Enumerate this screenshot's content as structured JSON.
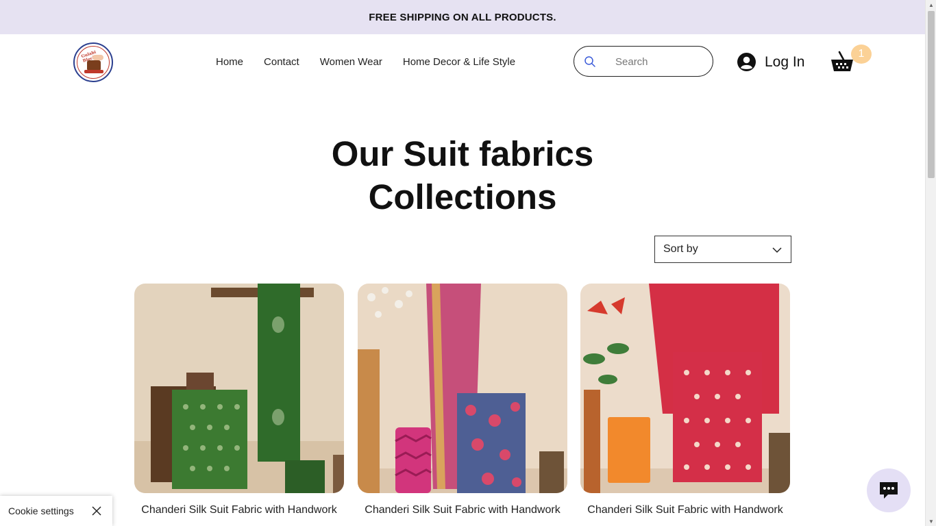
{
  "promo": {
    "text": "FREE SHIPPING ON ALL PRODUCTS."
  },
  "header": {
    "logo_text": "Gulabi Blocks",
    "nav": [
      "Home",
      "Contact",
      "Women Wear",
      "Home Decor & Life Style"
    ],
    "search_placeholder": "Search",
    "login_label": "Log In",
    "cart_count": "1"
  },
  "main": {
    "title_line1": "Our Suit fabrics",
    "title_line2": "Collections",
    "sort_label": "Sort by",
    "products": [
      {
        "title": "Chanderi Silk Suit Fabric with Handwork"
      },
      {
        "title": "Chanderi Silk Suit Fabric with Handwork"
      },
      {
        "title": "Chanderi Silk Suit Fabric with Handwork"
      }
    ]
  },
  "cookie": {
    "label": "Cookie settings"
  },
  "colors": {
    "promo_bg": "#e6e2f2",
    "cart_badge": "#fbd196",
    "chat_bg": "#e4dff5"
  },
  "icons": {
    "search": "search-icon",
    "user": "user-avatar-icon",
    "cart": "cart-basket-icon",
    "chevron": "chevron-down-icon",
    "close": "close-icon",
    "chat": "chat-bubble-icon"
  }
}
